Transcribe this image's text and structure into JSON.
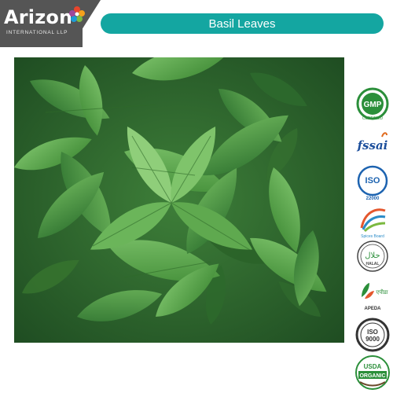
{
  "header": {
    "brand_name": "Arizone",
    "brand_tagline": "INTERNATIONAL LLP",
    "title": "Basil Leaves"
  },
  "photo": {
    "subject": "basil-leaves-photo"
  },
  "badges": [
    {
      "icon": "gmp-icon",
      "label": "GMP",
      "sublabel": "CERTIFIED"
    },
    {
      "icon": "fssai-icon",
      "label": "fssai"
    },
    {
      "icon": "iso-22000-icon",
      "label": "ISO",
      "sublabel": "22000"
    },
    {
      "icon": "spices-board-icon",
      "label": "Spices Board"
    },
    {
      "icon": "halal-icon",
      "label": "حلال",
      "sublabel": "HALAL"
    },
    {
      "icon": "apeda-icon",
      "label": "एपीडा",
      "sublabel": "APEDA"
    },
    {
      "icon": "iso-9000-icon",
      "label": "ISO",
      "sublabel": "9000"
    },
    {
      "icon": "usda-organic-icon",
      "label": "USDA",
      "sublabel": "ORGANIC"
    }
  ],
  "colors": {
    "header_dark": "#555555",
    "title_bar": "#14a6a1",
    "leaf_green": "#4d9a3e"
  }
}
